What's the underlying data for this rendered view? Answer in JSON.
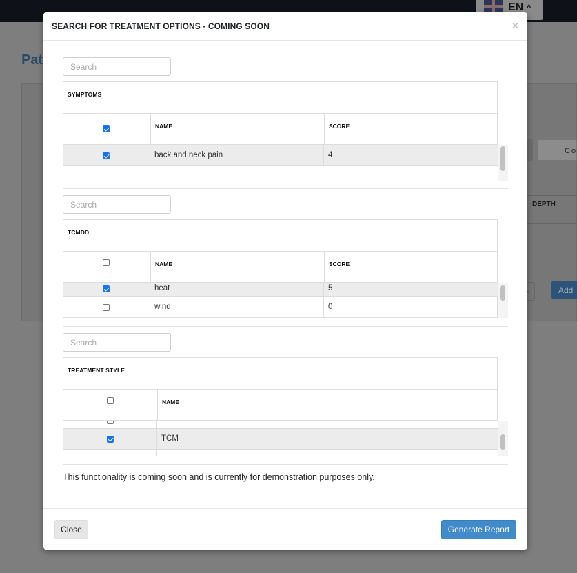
{
  "background": {
    "language": "EN",
    "language_chevron": "^",
    "page_title_fragment": "Pati",
    "tab_fragment": "Co",
    "depth_header": "DEPTH",
    "add_button_label": "Add",
    "select_chevron": "⌄"
  },
  "modal": {
    "title": "SEARCH FOR TREATMENT OPTIONS - COMING SOON",
    "close_symbol": "×",
    "notice": "This functionality is coming soon and is currently for demonstration purposes only.",
    "footer": {
      "close_label": "Close",
      "generate_label": "Generate Report"
    }
  },
  "symptoms": {
    "search_placeholder": "Search",
    "title": "SYMPTOMS",
    "select_all_checked": true,
    "columns": [
      "NAME",
      "SCORE"
    ],
    "rows": [
      {
        "name": "back and neck pain",
        "score": "4",
        "checked": true
      }
    ]
  },
  "tcmdd": {
    "search_placeholder": "Search",
    "title": "TCMDD",
    "select_all_checked": false,
    "columns": [
      "NAME",
      "SCORE"
    ],
    "rows": [
      {
        "name": "heat",
        "score": "5",
        "checked": true
      },
      {
        "name": "wind",
        "score": "0",
        "checked": false
      }
    ]
  },
  "treatment_style": {
    "search_placeholder": "Search",
    "title": "TREATMENT STYLE",
    "select_all_checked": false,
    "columns": [
      "NAME"
    ],
    "rows": [
      {
        "name": "",
        "checked": false
      },
      {
        "name": "TCM",
        "checked": true
      },
      {
        "name": "",
        "checked": false
      }
    ]
  },
  "colors": {
    "primary": "#428bca",
    "checkbox": "#1a73e8",
    "selected_row": "#ececec"
  }
}
